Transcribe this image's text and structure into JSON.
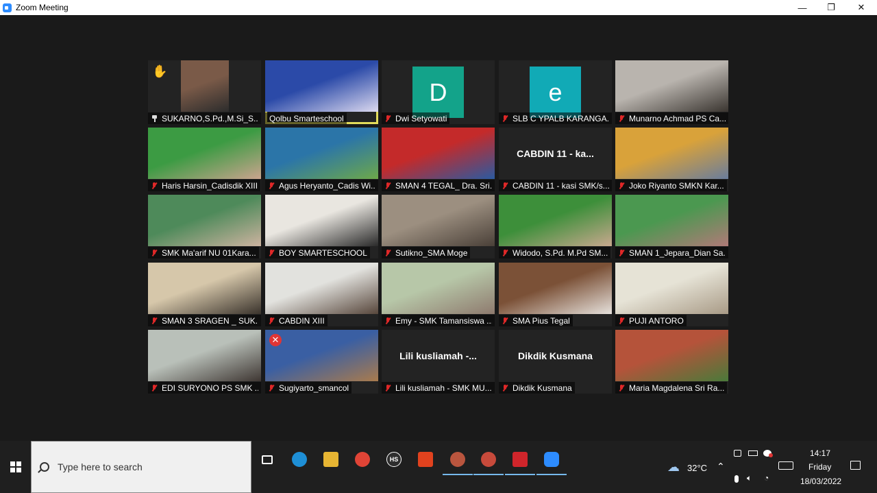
{
  "window": {
    "title": "Zoom Meeting",
    "controls": {
      "minimize": "—",
      "maximize": "❐",
      "close": "✕"
    }
  },
  "gallery": {
    "active_speaker_color": "#e3dc5b",
    "participants": [
      {
        "name": "SUKARNO,S.Pd.,M.Si_S...",
        "kind": "video",
        "pinned": true,
        "raised_hand": true,
        "hand_icon": "✋",
        "muted": false,
        "colors": [
          "#7a5a48",
          "#2c2c2c"
        ]
      },
      {
        "name": "Qolbu Smarteschool",
        "kind": "video",
        "active": true,
        "muted": false,
        "colors": [
          "#2b4aa8",
          "#dcd9ef"
        ]
      },
      {
        "name": "Dwi Setyowati",
        "kind": "initial",
        "initial": "D",
        "avatar_color": "#13a38a",
        "muted": true
      },
      {
        "name": "SLB C YPALB KARANGA...",
        "kind": "initial",
        "initial": "e",
        "avatar_color": "#11aab6",
        "muted": true
      },
      {
        "name": "Munarno Achmad PS Ca...",
        "kind": "video",
        "muted": true,
        "colors": [
          "#b9b4ae",
          "#3a3530"
        ]
      },
      {
        "name": "Haris Harsin_Cadisdik XIII",
        "kind": "video",
        "muted": true,
        "colors": [
          "#3c9b43",
          "#caa48e"
        ]
      },
      {
        "name": "Agus Heryanto_Cadis Wi...",
        "kind": "video",
        "muted": true,
        "colors": [
          "#2b75a8",
          "#6da84a"
        ]
      },
      {
        "name": "SMAN 4 TEGAL_ Dra. Sri...",
        "kind": "video",
        "muted": true,
        "colors": [
          "#c42a2a",
          "#2b5aa0"
        ]
      },
      {
        "name": "CABDIN 11 - kasi SMK/s...",
        "kind": "text",
        "big_label": "CABDIN 11 - ka...",
        "muted": true
      },
      {
        "name": "Joko Riyanto SMKN Kar...",
        "kind": "video",
        "muted": true,
        "colors": [
          "#d9a23a",
          "#6a7d9c"
        ]
      },
      {
        "name": "SMK Ma'arif NU 01Kara...",
        "kind": "video",
        "muted": true,
        "colors": [
          "#4e8a5a",
          "#cdb3a0"
        ]
      },
      {
        "name": "BOY SMARTESCHOOL",
        "kind": "video",
        "muted": true,
        "colors": [
          "#e9e6e0",
          "#2a2a2a"
        ]
      },
      {
        "name": "Sutikno_SMA Moge",
        "kind": "video",
        "muted": true,
        "colors": [
          "#9c8f80",
          "#4a4038"
        ]
      },
      {
        "name": "Widodo, S.Pd. M.Pd SM...",
        "kind": "video",
        "muted": true,
        "colors": [
          "#3d8f3a",
          "#c8a88e"
        ]
      },
      {
        "name": "SMAN 1_Jepara_Dian Sa...",
        "kind": "video",
        "muted": true,
        "colors": [
          "#4b9850",
          "#b07a78"
        ]
      },
      {
        "name": "SMAN 3 SRAGEN _ SUK...",
        "kind": "video",
        "muted": true,
        "colors": [
          "#d6c7aa",
          "#3a332c"
        ]
      },
      {
        "name": "CABDIN XIII",
        "kind": "video",
        "muted": true,
        "colors": [
          "#e2e2de",
          "#57463b"
        ]
      },
      {
        "name": "Emy - SMK Tamansiswa ...",
        "kind": "video",
        "muted": true,
        "colors": [
          "#b7c7a8",
          "#8e7a6e"
        ]
      },
      {
        "name": "SMA Pius Tegal",
        "kind": "video",
        "muted": true,
        "colors": [
          "#7b5137",
          "#e6e1dc"
        ]
      },
      {
        "name": "PUJI ANTORO",
        "kind": "video",
        "muted": true,
        "colors": [
          "#e6e3d6",
          "#a89a86"
        ]
      },
      {
        "name": "EDI SURYONO PS SMK ...",
        "kind": "video",
        "muted": true,
        "colors": [
          "#b9c0b9",
          "#3e3632"
        ]
      },
      {
        "name": "Sugiyarto_smancol",
        "kind": "video",
        "muted": true,
        "video_stopped_badge": true,
        "badge_icon": "✕",
        "colors": [
          "#3a5fa3",
          "#a97b4d"
        ]
      },
      {
        "name": "Lili kusliamah - SMK MU...",
        "kind": "text",
        "big_label": "Lili  kusliamah  -...",
        "muted": true
      },
      {
        "name": "Dikdik Kusmana",
        "kind": "text",
        "big_label": "Dikdik Kusmana",
        "muted": true
      },
      {
        "name": "Maria Magdalena Sri Ra...",
        "kind": "video",
        "muted": true,
        "colors": [
          "#b5533a",
          "#4a7a3a"
        ]
      }
    ]
  },
  "taskbar": {
    "search_placeholder": "Type here to search",
    "apps": [
      {
        "name": "task-view-icon",
        "running": false
      },
      {
        "name": "edge-icon",
        "color": "#1e8fd6",
        "running": false
      },
      {
        "name": "file-explorer-icon",
        "color": "#e7b533",
        "running": false
      },
      {
        "name": "chrome-icon",
        "color": "#e04436",
        "running": false
      },
      {
        "name": "hs-app-icon",
        "color": "#2e2e2e",
        "label": "HS",
        "running": false
      },
      {
        "name": "office-icon",
        "color": "#e1421e",
        "running": false
      },
      {
        "name": "chrome-profile-k-icon",
        "color": "#b9553e",
        "running": true
      },
      {
        "name": "chrome-profile-2-icon",
        "color": "#c74a3b",
        "running": true
      },
      {
        "name": "pdf-app-icon",
        "color": "#d0252b",
        "running": true
      },
      {
        "name": "zoom-icon",
        "color": "#2d8cff",
        "running": true
      }
    ],
    "weather": {
      "temperature": "32°C",
      "icon": "☁"
    },
    "clock": {
      "time": "14:17",
      "day": "Friday",
      "date": "18/03/2022"
    }
  }
}
